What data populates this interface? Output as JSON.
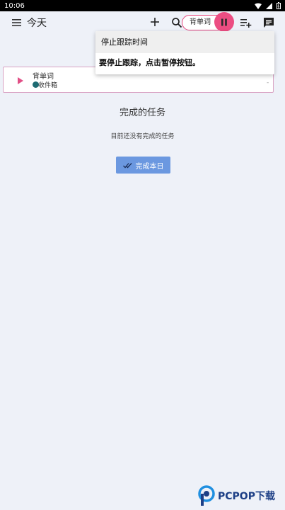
{
  "status_bar": {
    "time": "10:06"
  },
  "app_bar": {
    "title": "今天",
    "tracking_chip_label": "背单词",
    "icons": [
      "menu-icon",
      "plus-icon",
      "search-icon",
      "pause-icon",
      "playlist-add-icon",
      "comment-icon"
    ]
  },
  "tooltip": {
    "title": "停止跟踪时间",
    "body": "要停止跟踪，点击暂停按钮。"
  },
  "task": {
    "name": "背单词",
    "project": "收件箱",
    "trailing": "-"
  },
  "completed": {
    "heading": "完成的任务",
    "empty_text": "目前还没有完成的任务",
    "button_label": "完成本日"
  },
  "watermark": {
    "text": "PCPOP下载"
  },
  "colors": {
    "accent_pink": "#ec4d82",
    "button_blue": "#6b98e0",
    "project_dot": "#1e6b72",
    "background": "#eef1f8"
  }
}
